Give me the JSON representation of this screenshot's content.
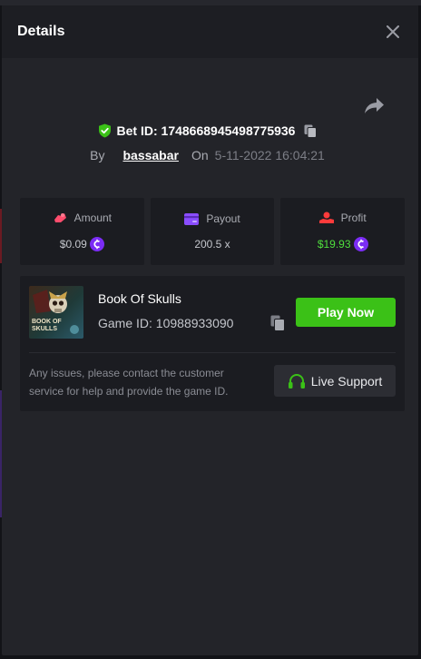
{
  "modal": {
    "title": "Details"
  },
  "bet": {
    "id_label": "Bet ID: 1748668945498775936",
    "by_label": "By",
    "username": "bassabar",
    "on_label": "On",
    "date": "5-11-2022 16:04:21"
  },
  "stats": {
    "amount": {
      "label": "Amount",
      "value": "$0.09",
      "icon": "wallet-hand-icon"
    },
    "payout": {
      "label": "Payout",
      "value": "200.5 x",
      "icon": "card-icon"
    },
    "profit": {
      "label": "Profit",
      "value": "$19.93",
      "icon": "coin-hand-icon"
    }
  },
  "game": {
    "name": "Book Of Skulls",
    "id_label": "Game ID: 10988933090",
    "thumb_line1": "BOOK OF",
    "thumb_line2": "SKULLS",
    "play_label": "Play Now"
  },
  "support": {
    "help_text": "Any issues, please contact the customer service for help and provide the game ID.",
    "button_label": "Live Support"
  },
  "colors": {
    "accent_green": "#3bc117",
    "profit_green": "#4fdf3d",
    "coin_purple": "#7b2cf5",
    "amount_pink": "#ff4d6d",
    "payout_purple": "#8a4dff",
    "profit_red": "#ff3b3b"
  }
}
